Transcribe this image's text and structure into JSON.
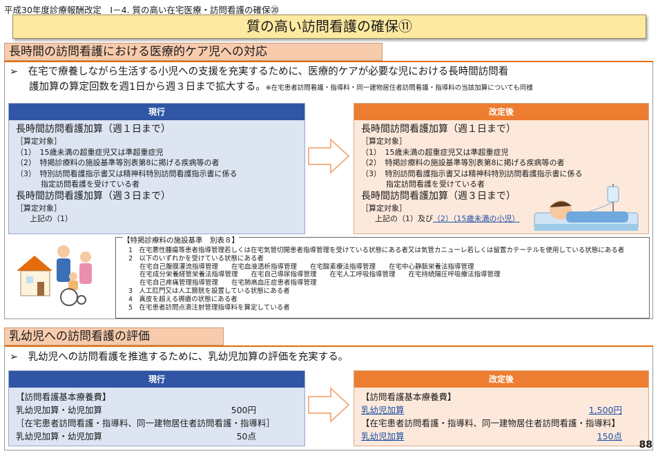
{
  "header": "平成30年度診療報酬改定　Ⅰ－4. 質の高い在宅医療・訪問看護の確保⑳",
  "title": "質の高い訪問看護の確保⑪",
  "section1": {
    "heading": "長時間の訪問看護における医療的ケア児への対応",
    "lead_line1": "➢　在宅で療養しながら生活する小児への支援を充実するために、医療的ケアが必要な児における長時間訪問看",
    "lead_line2": "護加算の算定回数を週1日から週３日まで拡大する。",
    "lead_note": "※在宅患者訪問看護・指導料・同一建物居住者訪問看護・指導料の当該加算についても同様",
    "current": {
      "header": "現行",
      "item1_title": "長時間訪問看護加算（週１日まで）",
      "item1_label": "［算定対象］",
      "item1_l1": "（1）　15歳未満の超重症児又は準超重症児",
      "item1_l2": "（2）　特掲診療料の施設基準等別表第8に掲げる疾病等の者",
      "item1_l3": "（3）　特別訪問看護指示書又は精神科特別訪問看護指示書に係る",
      "item1_l4": "指定訪問看護を受けている者",
      "item2_title": "長時間訪問看護加算（週３日まで）",
      "item2_label": "［算定対象］",
      "item2_l1": "上記の（1）"
    },
    "revised": {
      "header": "改定後",
      "item1_title": "長時間訪問看護加算（週１日まで）",
      "item1_label": "［算定対象］",
      "item1_l1": "（1）　15歳未満の超重症児又は準超重症児",
      "item1_l2": "（2）　特掲診療料の施設基準等別表第8に掲げる疾病等の者",
      "item1_l3": "（3）　特別訪問看護指示書又は精神科特別訪問看護指示書に係る",
      "item1_l4": "指定訪問看護を受けている者",
      "item2_title": "長時間訪問看護加算（週３日まで）",
      "item2_label": "［算定対象］",
      "item2_l1a": "上記の（1）及び",
      "item2_l1b": "（2）（15歳未満の小児）"
    },
    "table8": {
      "title": "【特掲診療料の施設基準　別表８】",
      "lines": [
        "1　在宅悪性腫瘍等患者指導管理若しくは在宅気管切開患者指導管理を受けている状態にある者又は気管カニューレ若しくは留置カテーテルを使用している状態にある者",
        "2　以下のいずれかを受けている状態にある者",
        "在宅自己腹膜灌流指導管理　　在宅血液透析指導管理　　在宅酸素療法指導管理　　在宅中心静脈栄養法指導管理",
        "在宅成分栄養経管栄養法指導管理　　在宅自己導尿指導管理　　在宅人工呼吸指導管理　　在宅持続陽圧呼吸療法指導管理",
        "在宅自己疼痛管理指導管理　　在宅肺高血圧症患者指導管理",
        "3　人工肛門又は人工膀胱を設置している状態にある者",
        "4　真皮を超える褥瘡の状態にある者",
        "5　在宅患者訪問点滴注射管理指導料を算定している者"
      ]
    }
  },
  "section2": {
    "heading": "乳幼児への訪問看護の評価",
    "lead": "➢　乳幼児への訪問看護を推進するために、乳幼児加算の評価を充実する。",
    "current": {
      "header": "現行",
      "l1": "【訪問看護基本療養費】",
      "l2_label": "乳幼児加算・幼児加算",
      "l2_value": "500円",
      "l3": "［在宅患者訪問看護・指導料、同一建物居住者訪問看護・指導料］",
      "l4_label": "乳幼児加算・幼児加算",
      "l4_value": "50点"
    },
    "revised": {
      "header": "改定後",
      "l1": "【訪問看護基本療養費】",
      "l2_label": "乳幼児加算",
      "l2_value": "1,500円",
      "l3": "【在宅患者訪問看護・指導料、同一建物居住者訪問看護・指導料】",
      "l4_label": "乳幼児加算",
      "l4_value": "150点"
    }
  },
  "page_number": "88"
}
